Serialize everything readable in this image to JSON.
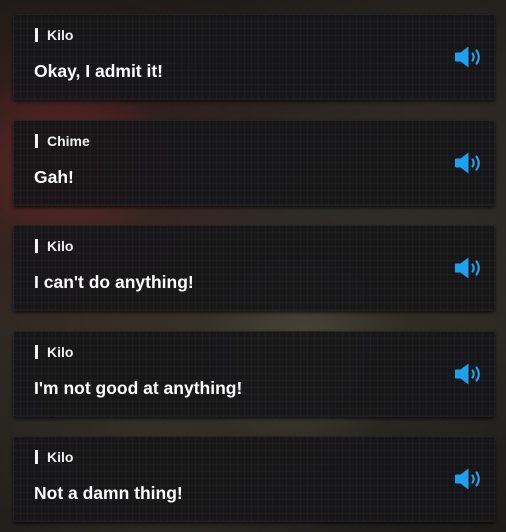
{
  "accent_color": "#1ea0f0",
  "log": [
    {
      "speaker": "Kilo",
      "text": "Okay, I admit it!",
      "voice_icon": "speaker-volume-icon"
    },
    {
      "speaker": "Chime",
      "text": "Gah!",
      "voice_icon": "speaker-volume-icon"
    },
    {
      "speaker": "Kilo",
      "text": "I can't do anything!",
      "voice_icon": "speaker-volume-icon"
    },
    {
      "speaker": "Kilo",
      "text": "I'm not good at anything!",
      "voice_icon": "speaker-volume-icon"
    },
    {
      "speaker": "Kilo",
      "text": "Not a damn thing!",
      "voice_icon": "speaker-volume-icon"
    }
  ]
}
